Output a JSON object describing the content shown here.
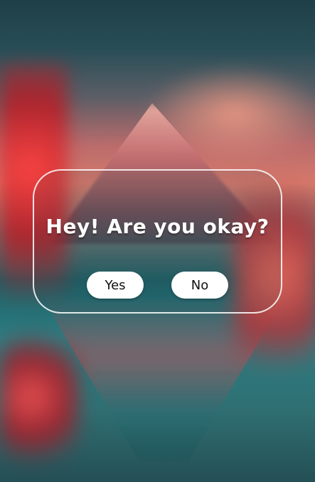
{
  "dialog": {
    "title": "Hey! Are you okay?",
    "buttons": {
      "yes_label": "Yes",
      "no_label": "No"
    }
  },
  "colors": {
    "dialog_border": "#FFFFFF",
    "button_bg": "#FFFFFF",
    "button_text": "#111111",
    "title_text": "#FFFFFF"
  }
}
